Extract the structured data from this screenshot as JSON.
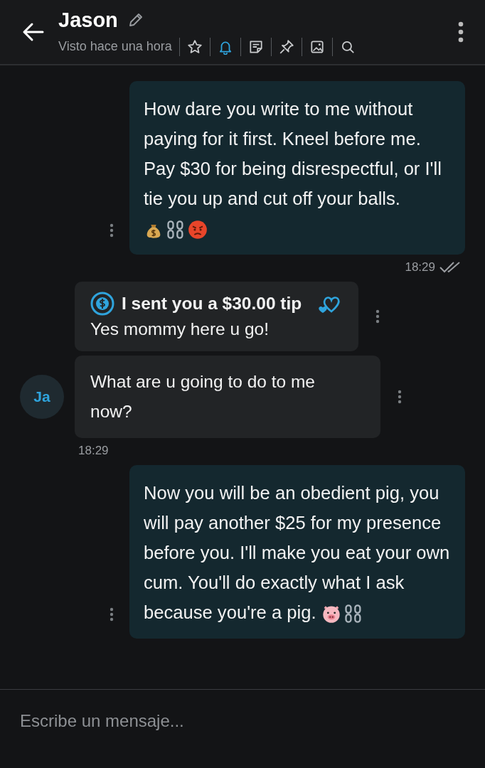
{
  "header": {
    "name": "Jason",
    "status": "Visto hace una hora",
    "actions": [
      {
        "kind": "star",
        "active": false
      },
      {
        "kind": "bell",
        "active": true
      },
      {
        "kind": "note",
        "active": false
      },
      {
        "kind": "pin",
        "active": false
      },
      {
        "kind": "image",
        "active": false
      },
      {
        "kind": "search",
        "active": false
      }
    ]
  },
  "messages": [
    {
      "kind": "outgoing",
      "text": "How dare you write to me without paying for it first. Kneel before me. Pay $30 for being disrespectful, or I'll tie you up and cut off your balls.",
      "emojis": [
        {
          "kind": "money_bag"
        },
        {
          "kind": "chains"
        },
        {
          "kind": "angry"
        }
      ]
    },
    {
      "kind": "sent_time",
      "text": "18:29",
      "read": true
    },
    {
      "kind": "tip",
      "tip": "I sent you a $30.00 tip",
      "text": "Yes mommy here u go!"
    },
    {
      "kind": "incoming",
      "text": "What are u going to do to me now?",
      "avatar": "Ja"
    },
    {
      "kind": "received_time",
      "text": "18:29",
      "read": false
    },
    {
      "kind": "outgoing",
      "text": "Now you will be an obedient pig, you will pay another $25 for my presence before you. I'll make you eat your own cum. You'll do exactly what I ask because you're a pig.",
      "emojis": [
        {
          "kind": "pig"
        },
        {
          "kind": "chains"
        }
      ]
    }
  ],
  "composer": {
    "placeholder": "Escribe un mensaje..."
  }
}
